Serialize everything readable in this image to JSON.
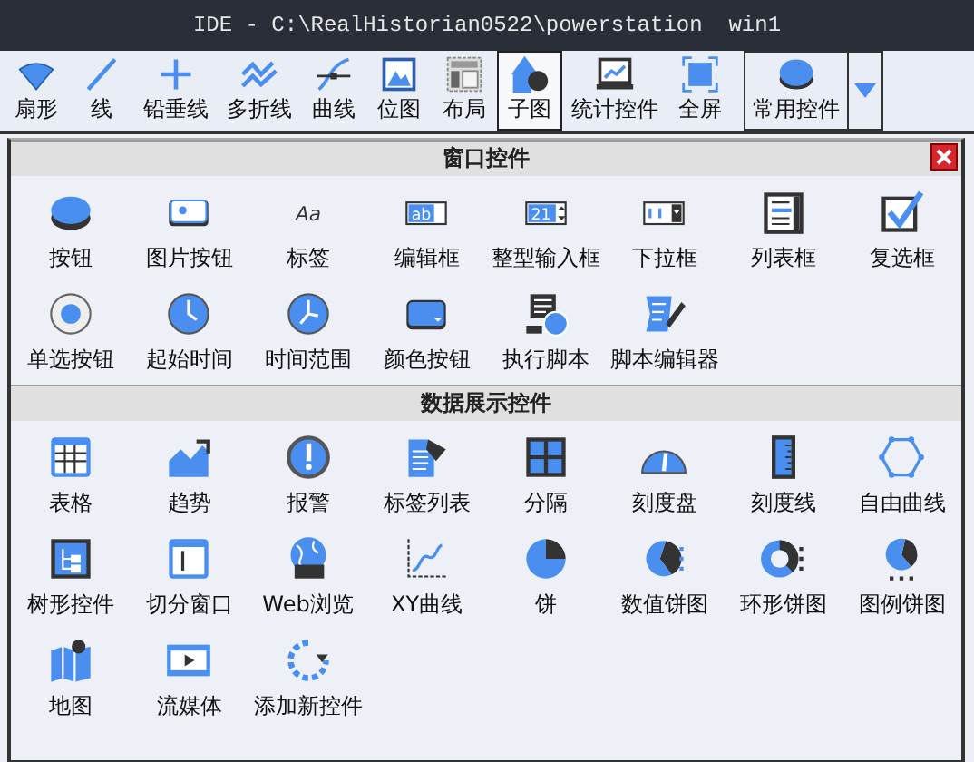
{
  "window": {
    "title": "IDE - C:\\RealHistorian0522\\powerstation  win1"
  },
  "toolbar": [
    {
      "label": "扇形",
      "kind": "tool",
      "selected": false
    },
    {
      "label": "线",
      "kind": "tool",
      "selected": false
    },
    {
      "label": "铅垂线",
      "kind": "tool",
      "selected": false
    },
    {
      "label": "多折线",
      "kind": "tool",
      "selected": false
    },
    {
      "label": "曲线",
      "kind": "tool",
      "selected": false
    },
    {
      "label": "位图",
      "kind": "tool",
      "selected": false
    },
    {
      "label": "布局",
      "kind": "tool",
      "selected": false
    },
    {
      "label": "子图",
      "kind": "tool",
      "selected": true
    },
    {
      "label": "统计控件",
      "kind": "tool",
      "selected": false
    },
    {
      "label": "全屏",
      "kind": "tool",
      "selected": false
    },
    {
      "label": "常用控件",
      "kind": "dropdown",
      "selected": false
    }
  ],
  "panel": {
    "sections": [
      {
        "title": "窗口控件",
        "items": [
          {
            "label": "按钮"
          },
          {
            "label": "图片按钮"
          },
          {
            "label": "标签",
            "glyph": "Aa"
          },
          {
            "label": "编辑框",
            "glyph": "ab"
          },
          {
            "label": "整型输入框",
            "glyph": "21"
          },
          {
            "label": "下拉框"
          },
          {
            "label": "列表框"
          },
          {
            "label": "复选框"
          },
          {
            "label": "单选按钮"
          },
          {
            "label": "起始时间"
          },
          {
            "label": "时间范围"
          },
          {
            "label": "颜色按钮"
          },
          {
            "label": "执行脚本"
          },
          {
            "label": "脚本编辑器"
          }
        ]
      },
      {
        "title": "数据展示控件",
        "items": [
          {
            "label": "表格"
          },
          {
            "label": "趋势"
          },
          {
            "label": "报警"
          },
          {
            "label": "标签列表"
          },
          {
            "label": "分隔"
          },
          {
            "label": "刻度盘"
          },
          {
            "label": "刻度线"
          },
          {
            "label": "自由曲线"
          },
          {
            "label": "树形控件"
          },
          {
            "label": "切分窗口"
          },
          {
            "label": "Web浏览"
          },
          {
            "label": "XY曲线"
          },
          {
            "label": "饼"
          },
          {
            "label": "数值饼图"
          },
          {
            "label": "环形饼图"
          },
          {
            "label": "图例饼图"
          },
          {
            "label": "地图"
          },
          {
            "label": "流媒体"
          },
          {
            "label": "添加新控件"
          }
        ]
      }
    ]
  }
}
